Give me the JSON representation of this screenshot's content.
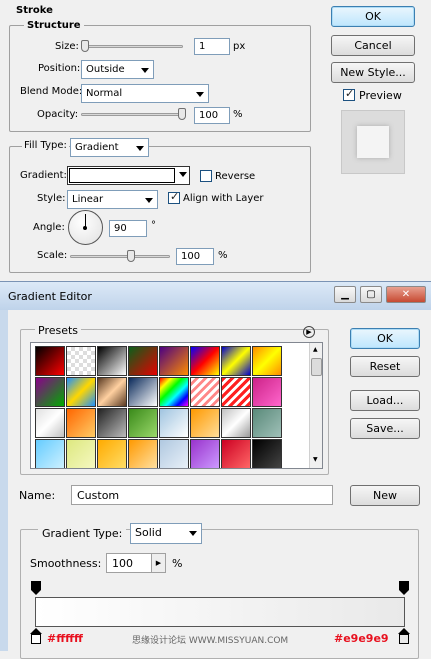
{
  "layer_style": {
    "stroke_title": "Stroke",
    "structure_title": "Structure",
    "size_label": "Size:",
    "size_value": "1",
    "size_unit": "px",
    "position_label": "Position:",
    "position_value": "Outside",
    "blend_mode_label": "Blend Mode:",
    "blend_mode_value": "Normal",
    "opacity_label": "Opacity:",
    "opacity_value": "100",
    "percent": "%",
    "fill_type_label": "Fill Type:",
    "fill_type_value": "Gradient",
    "gradient_label": "Gradient:",
    "reverse_label": "Reverse",
    "reverse_checked": false,
    "style_label": "Style:",
    "style_value": "Linear",
    "align_label": "Align with Layer",
    "align_checked": true,
    "angle_label": "Angle:",
    "angle_value": "90",
    "degree": "°",
    "scale_label": "Scale:",
    "scale_value": "100",
    "ok_label": "OK",
    "cancel_label": "Cancel",
    "new_style_label": "New Style...",
    "preview_label": "Preview",
    "preview_checked": true
  },
  "gradient_editor": {
    "title": "Gradient Editor",
    "presets_label": "Presets",
    "ok_label": "OK",
    "reset_label": "Reset",
    "load_label": "Load...",
    "save_label": "Save...",
    "name_label": "Name:",
    "name_value": "Custom",
    "new_label": "New",
    "gradient_type_label": "Gradient Type:",
    "gradient_type_value": "Solid",
    "smoothness_label": "Smoothness:",
    "smoothness_value": "100",
    "percent": "%",
    "left_stop_color": "#ffffff",
    "right_stop_color": "#e9e9e9",
    "left_stop_label": "#ffffff",
    "right_stop_label": "#e9e9e9",
    "watermark": "思缘设计论坛 WWW.MISSYUAN.COM",
    "window_buttons": [
      "minimize-icon",
      "maximize-icon",
      "close-icon"
    ]
  },
  "preset_swatches": [
    "linear-gradient(135deg,#000,#ff0000)",
    "repeating-conic-gradient(#ddd 0 25%,#fff 0 50%) 0 0/8px 8px, linear-gradient(135deg,#ff0000,#ff8080)",
    "linear-gradient(135deg,#000,#fff)",
    "linear-gradient(135deg,#0a5f1a,#e60000)",
    "linear-gradient(135deg,#4b0082,#ff8c00)",
    "linear-gradient(135deg,#0000ff,#ff0000,#ffff00)",
    "linear-gradient(135deg,#0000cc,#ffff00,#0000cc)",
    "linear-gradient(135deg,#ff8c00,#ffff00,#ff8c00)",
    "linear-gradient(135deg,#8b008b,#00aa00)",
    "linear-gradient(135deg,#1e90ff,#ffd700,#1e90ff)",
    "linear-gradient(135deg,#5a3a22,#ffd0a0,#5a3a22)",
    "linear-gradient(135deg,#0a2a5a,#ffffff)",
    "linear-gradient(135deg,#ff0000,#ffff00,#00ff00,#00ffff,#0000ff,#ff00ff)",
    "repeating-linear-gradient(135deg,#fff 0 3px,#ff8888 3px 6px)",
    "repeating-linear-gradient(135deg,#ff2020 0 3px,#fff 3px 6px)",
    "linear-gradient(135deg,#cc2288,#ff66cc)",
    "linear-gradient(135deg,#e0e0e0,#ffffff,#c0c0c0)",
    "linear-gradient(135deg,#ff6600,#ffcc66)",
    "linear-gradient(135deg,#222,#bbbbbb)",
    "linear-gradient(135deg,#3a8a1a,#9ad86a)",
    "linear-gradient(135deg,#a0c4e0,#ffffff)",
    "linear-gradient(135deg,#ff9900,#ffdd99)",
    "linear-gradient(135deg,#c0c0c0,#ffffff,#999999)",
    "linear-gradient(135deg,#5a8a7a,#a0c0b8)",
    "linear-gradient(135deg,#66ccff,#ccf0ff)",
    "linear-gradient(135deg,#dde880,#f5f8c0)",
    "linear-gradient(135deg,#ffaa00,#ffdd66)",
    "linear-gradient(135deg,#ff9900,#ffe0a0)",
    "linear-gradient(135deg,#b0c8e0,#e8f0f8)",
    "linear-gradient(135deg,#9933cc,#cc99ff)",
    "linear-gradient(135deg,#cc0022,#ff6666)",
    "linear-gradient(135deg,#000,#444)"
  ]
}
